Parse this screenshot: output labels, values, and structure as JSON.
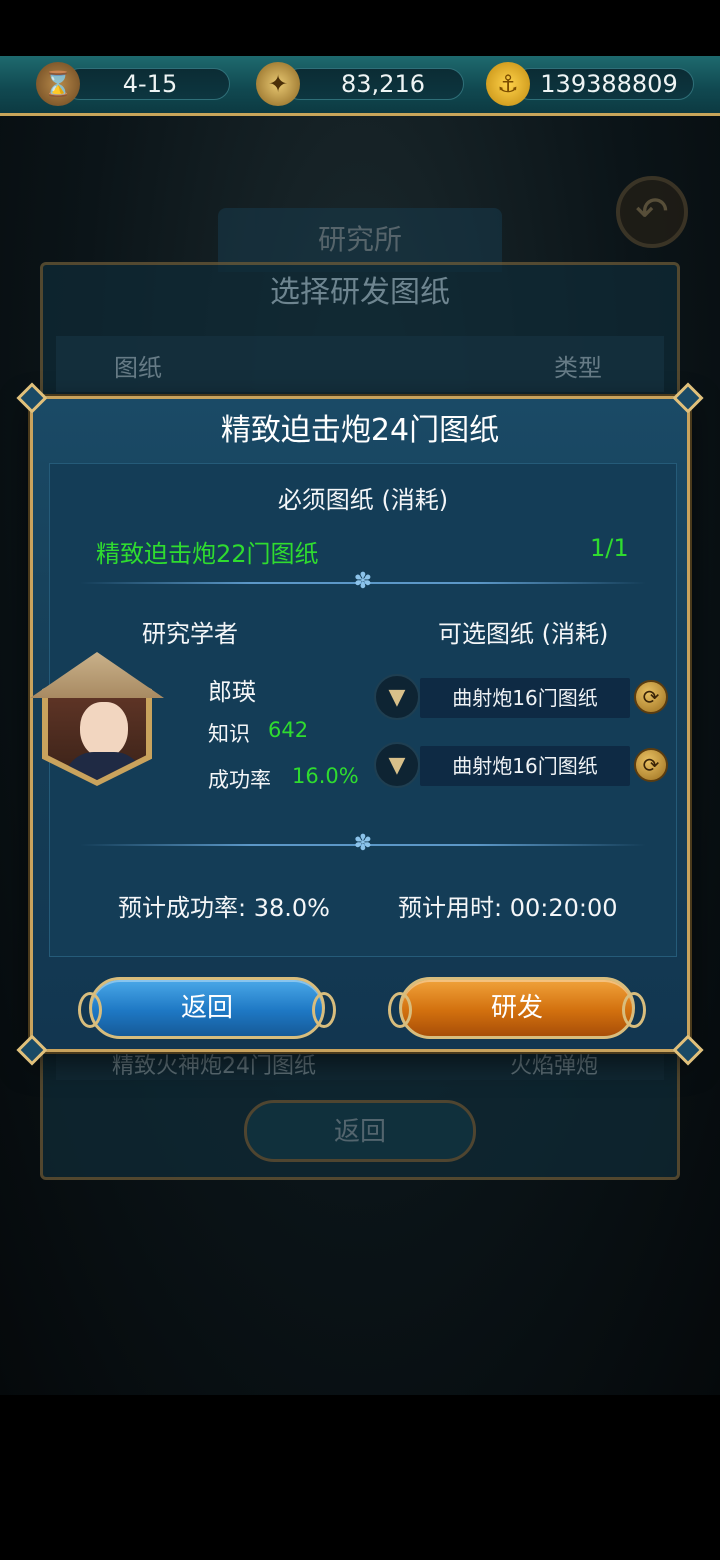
{
  "resources": {
    "date": "4-15",
    "compass_value": "83,216",
    "gold": "139388809"
  },
  "background": {
    "research_tab": "研究所",
    "panel_title": "选择研发图纸",
    "col_blueprint": "图纸",
    "col_type": "类型",
    "last_row_name": "精致火神炮24门图纸",
    "last_row_type": "火焰弹炮",
    "return_label": "返回"
  },
  "dialog": {
    "title": "精致迫击炮24门图纸",
    "required_label": "必须图纸 (消耗)",
    "required_item": "精致迫击炮22门图纸",
    "required_count": "1/1",
    "scholar_label": "研究学者",
    "optional_label": "可选图纸 (消耗)",
    "scholar_name": "郎瑛",
    "knowledge_label": "知识",
    "knowledge_value": "642",
    "success_label": "成功率",
    "success_value": "16.0%",
    "optional_items": [
      "曲射炮16门图纸",
      "曲射炮16门图纸"
    ],
    "estimated_success": "预计成功率: 38.0%",
    "estimated_time": "预计用时: 00:20:00",
    "back_button": "返回",
    "research_button": "研发"
  },
  "colors": {
    "accent_gold": "#c9a35d",
    "highlight_green": "#2fdc2f",
    "dialog_blue": "#1a4a66"
  }
}
